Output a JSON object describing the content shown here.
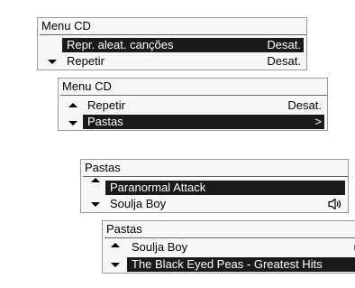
{
  "screen1": {
    "title": "Menu CD",
    "rows": [
      {
        "label": "Repr. aleat. canções",
        "value": "Desat."
      },
      {
        "label": "Repetir",
        "value": "Desat."
      }
    ]
  },
  "screen2": {
    "title": "Menu CD",
    "rows": [
      {
        "label": "Repetir",
        "value": "Desat."
      },
      {
        "label": "Pastas",
        "value": ">"
      }
    ]
  },
  "screen3": {
    "title": "Pastas",
    "rows": [
      {
        "label": "Paranormal Attack"
      },
      {
        "label": "Soulja Boy",
        "icon": "speaker-icon"
      }
    ]
  },
  "screen4": {
    "title": "Pastas",
    "rows": [
      {
        "label": "Soulja Boy",
        "icon": "speaker-icon"
      },
      {
        "label": "The Black Eyed Peas - Greatest Hits"
      }
    ]
  }
}
